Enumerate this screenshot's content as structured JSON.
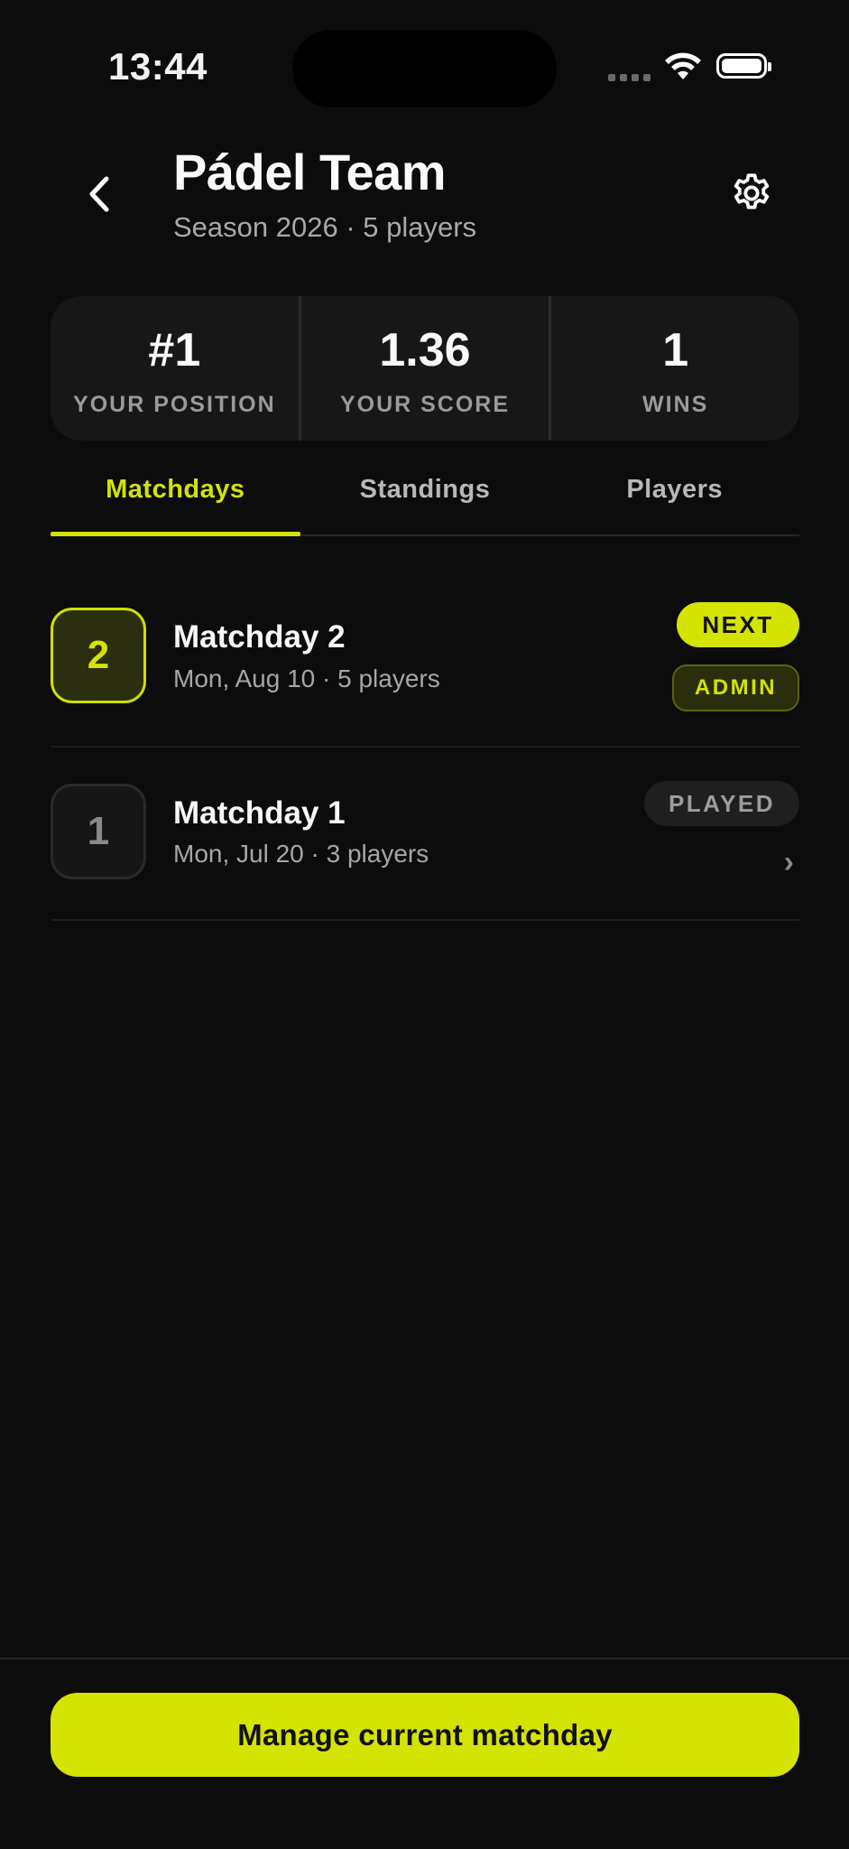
{
  "status_bar": {
    "time": "13:44"
  },
  "header": {
    "title": "Pádel Team",
    "subtitle": "Season 2026 · 5 players"
  },
  "stats": [
    {
      "value": "#1",
      "label": "YOUR POSITION"
    },
    {
      "value": "1.36",
      "label": "YOUR SCORE"
    },
    {
      "value": "1",
      "label": "WINS"
    }
  ],
  "tabs": [
    {
      "label": "Matchdays",
      "active": true
    },
    {
      "label": "Standings",
      "active": false
    },
    {
      "label": "Players",
      "active": false
    }
  ],
  "matchdays": [
    {
      "number": "2",
      "title": "Matchday 2",
      "subtitle": "Mon, Aug 10 · 5 players",
      "badges": [
        "NEXT",
        "ADMIN"
      ]
    },
    {
      "number": "1",
      "title": "Matchday 1",
      "subtitle": "Mon, Jul 20 · 3 players",
      "badges": [
        "PLAYED"
      ],
      "chevron": "›"
    }
  ],
  "cta": {
    "label": "Manage current matchday"
  },
  "colors": {
    "accent": "#d4e300",
    "background": "#0c0c0c",
    "card": "#171717"
  }
}
